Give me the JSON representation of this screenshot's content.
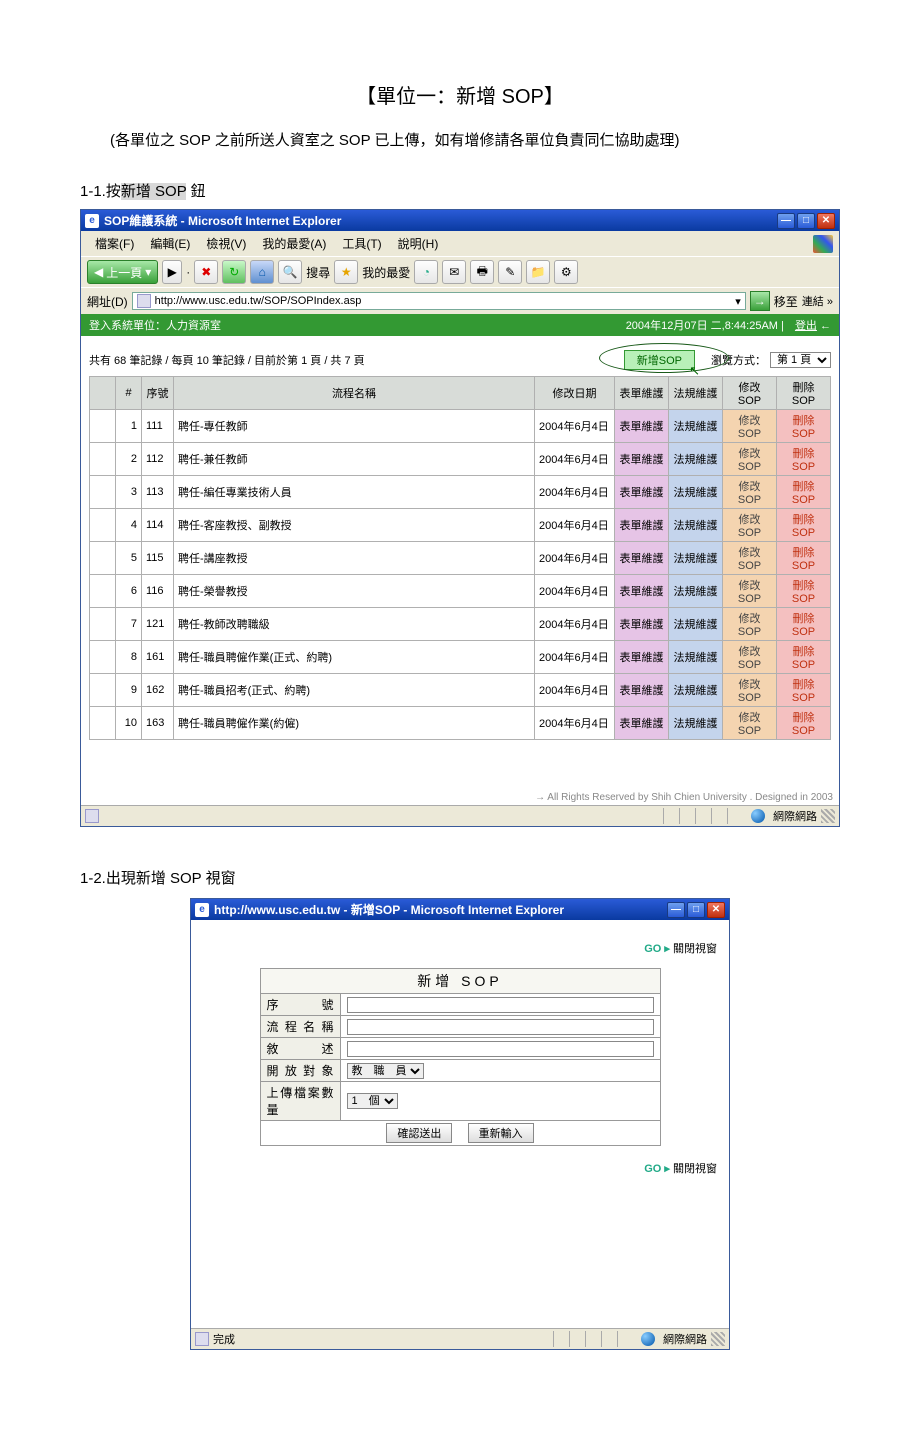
{
  "doc": {
    "title": "【單位一：新增 SOP】",
    "subtitle": "(各單位之 SOP 之前所送人資室之 SOP 已上傳，如有增修請各單位負責同仁協助處理)",
    "step1": {
      "prefix": "1-1.按",
      "hl": "新增 SOP",
      "suffix": " 鈕"
    },
    "step2": "1-2.出現新增 SOP 視窗"
  },
  "ie1": {
    "title": "SOP維護系統 - Microsoft Internet Explorer",
    "menu": {
      "file": "檔案(F)",
      "edit": "編輯(E)",
      "view": "檢視(V)",
      "fav": "我的最愛(A)",
      "tools": "工具(T)",
      "help": "說明(H)"
    },
    "toolbar": {
      "back": "上一頁",
      "search": "搜尋",
      "favorites": "我的最愛"
    },
    "address": {
      "label": "網址(D)",
      "url": "http://www.usc.edu.tw/SOP/SOPIndex.asp",
      "go": "移至",
      "links": "連結 »"
    },
    "greenbar": {
      "left": "登入系統單位：人力資源室",
      "time": "2004年12月07日 二,8:44:25AM",
      "logout": "登出"
    },
    "listHeader": {
      "paging": "共有 68 筆記錄 / 每頁 10 筆記錄 / 目前於第 1 頁 / 共 7 頁",
      "addBtn": "新增SOP",
      "browseLabel": "瀏覽方式：",
      "pageSel": "第 1 頁"
    },
    "columns": {
      "idx": "#",
      "seq": "序號",
      "name": "流程名稱",
      "date": "修改日期",
      "form": "表單維護",
      "law": "法規維護",
      "edit": "修改SOP",
      "del": "刪除SOP"
    },
    "cell": {
      "form": "表單維護",
      "law": "法規維護",
      "edit": "修改SOP",
      "del": "刪除SOP"
    },
    "rows": [
      {
        "i": "1",
        "seq": "111",
        "name": "聘任-專任教師",
        "date": "2004年6月4日"
      },
      {
        "i": "2",
        "seq": "112",
        "name": "聘任-兼任教師",
        "date": "2004年6月4日"
      },
      {
        "i": "3",
        "seq": "113",
        "name": "聘任-編任專業技術人員",
        "date": "2004年6月4日"
      },
      {
        "i": "4",
        "seq": "114",
        "name": "聘任-客座教授、副教授",
        "date": "2004年6月4日"
      },
      {
        "i": "5",
        "seq": "115",
        "name": "聘任-講座教授",
        "date": "2004年6月4日"
      },
      {
        "i": "6",
        "seq": "116",
        "name": "聘任-榮譽教授",
        "date": "2004年6月4日"
      },
      {
        "i": "7",
        "seq": "121",
        "name": "聘任-教師改聘職級",
        "date": "2004年6月4日"
      },
      {
        "i": "8",
        "seq": "161",
        "name": "聘任-職員聘僱作業(正式、約聘)",
        "date": "2004年6月4日"
      },
      {
        "i": "9",
        "seq": "162",
        "name": "聘任-職員招考(正式、約聘)",
        "date": "2004年6月4日"
      },
      {
        "i": "10",
        "seq": "163",
        "name": "聘任-職員聘僱作業(約僱)",
        "date": "2004年6月4日"
      }
    ],
    "footer": "→ All Rights Reserved by Shih Chien University . Designed in 2003",
    "status": {
      "zone": "網際網路"
    }
  },
  "ie2": {
    "title": "http://www.usc.edu.tw - 新增SOP - Microsoft Internet Explorer",
    "closeWin": {
      "go": "GO ▸",
      "label": "關閉視窗"
    },
    "form": {
      "caption": "新增 SOP",
      "seq": "序　　號",
      "name": "流 程 名 稱",
      "desc": "敘　　述",
      "target": "開 放 對 象",
      "targetOpt": "教　職　員",
      "upload": "上傳檔案數量",
      "uploadOpt": "1　個",
      "submit": "確認送出",
      "reset": "重新輸入"
    },
    "status": {
      "done": "完成",
      "zone": "網際網路"
    }
  }
}
